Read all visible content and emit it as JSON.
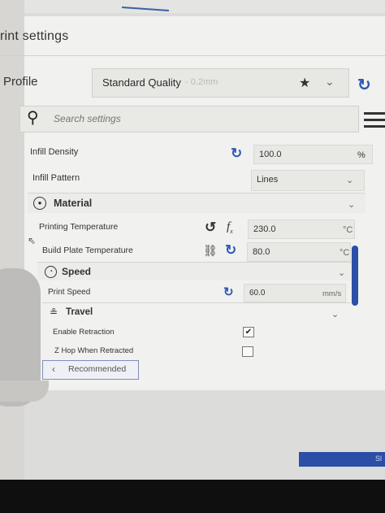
{
  "header": {
    "title": "rint settings"
  },
  "profile": {
    "label": "Profile",
    "name": "Standard Quality",
    "detail": "- 0.2mm",
    "favorite_icon": "star-icon",
    "dropdown_icon": "chevron-down-icon",
    "reset_icon": "reset-icon"
  },
  "search": {
    "placeholder": "Search settings",
    "icon": "search-icon",
    "menu_icon": "menu-icon"
  },
  "settings": {
    "infill_density": {
      "label": "Infill Density",
      "value": "100.0",
      "unit": "%"
    },
    "infill_pattern": {
      "label": "Infill Pattern",
      "value": "Lines"
    },
    "material": {
      "title": "Material",
      "printing_temperature": {
        "label": "Printing Temperature",
        "value": "230.0",
        "unit": "°C"
      },
      "build_plate_temperature": {
        "label": "Build Plate Temperature",
        "value": "80.0",
        "unit": "°C"
      }
    },
    "speed": {
      "title": "Speed",
      "print_speed": {
        "label": "Print Speed",
        "value": "60.0",
        "unit": "mm/s"
      }
    },
    "travel": {
      "title": "Travel",
      "enable_retraction": {
        "label": "Enable Retraction",
        "checked": true
      },
      "z_hop": {
        "label": "Z Hop When Retracted",
        "checked": false
      }
    }
  },
  "footer": {
    "recommended_label": "Recommended",
    "action_label": "Sl"
  },
  "colors": {
    "accent": "#2b4ea6",
    "reset_blue": "#2f58b5"
  }
}
